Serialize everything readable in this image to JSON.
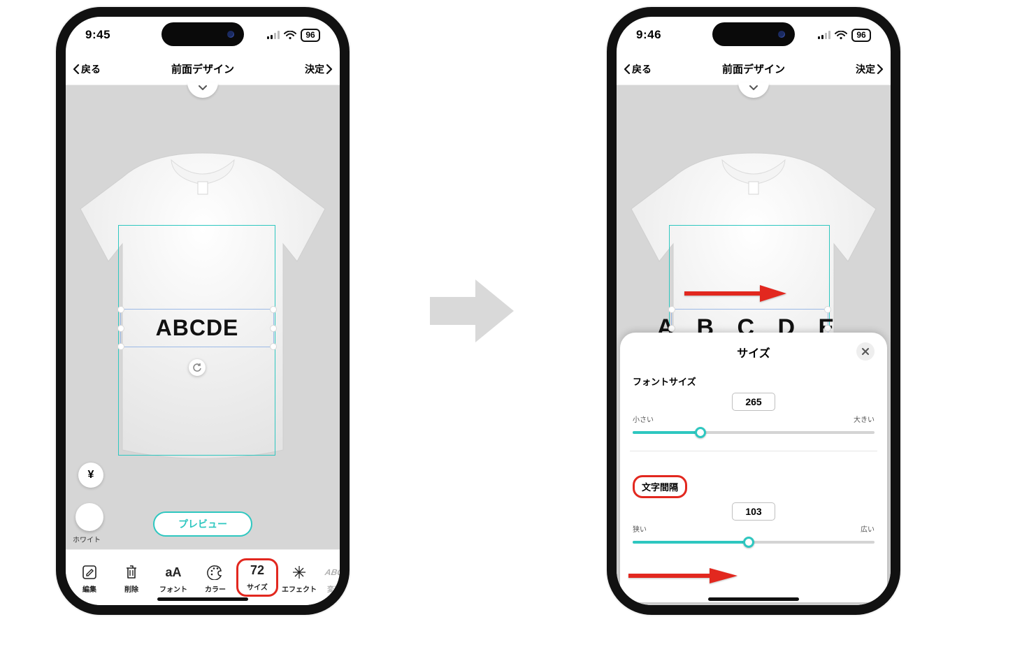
{
  "left": {
    "status": {
      "time": "9:45",
      "battery": "96"
    },
    "nav": {
      "back": "戻る",
      "title": "前面デザイン",
      "done": "決定"
    },
    "canvas": {
      "text": "ABCDE"
    },
    "price_symbol": "¥",
    "color_label": "ホワイト",
    "preview_label": "プレビュー",
    "toolbar": {
      "edit": {
        "label": "編集"
      },
      "delete": {
        "label": "削除"
      },
      "font": {
        "icon_text": "aA",
        "label": "フォント"
      },
      "color": {
        "label": "カラー"
      },
      "size": {
        "value": "72",
        "label": "サイズ"
      },
      "effect": {
        "label": "エフェクト"
      },
      "shape": {
        "icon_text": "ABC",
        "label": "変形"
      }
    }
  },
  "right": {
    "status": {
      "time": "9:46",
      "battery": "96"
    },
    "nav": {
      "back": "戻る",
      "title": "前面デザイン",
      "done": "決定"
    },
    "canvas": {
      "text": "A B C D E"
    },
    "panel": {
      "title": "サイズ",
      "font_size": {
        "label": "フォントサイズ",
        "value": "265",
        "min_label": "小さい",
        "max_label": "大きい",
        "fill_pct": 28
      },
      "spacing": {
        "label": "文字間隔",
        "value": "103",
        "min_label": "狭い",
        "max_label": "広い",
        "fill_pct": 48
      }
    }
  }
}
